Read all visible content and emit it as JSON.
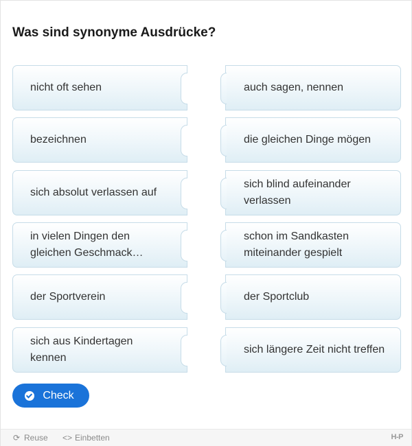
{
  "question": "Was sind synonyme Ausdrücke?",
  "pairs": [
    {
      "left": "nicht oft sehen",
      "right": "auch sagen, nennen"
    },
    {
      "left": "bezeichnen",
      "right": "die gleichen Dinge mögen"
    },
    {
      "left": "sich absolut verlassen auf",
      "right": "sich blind aufeinander verlassen"
    },
    {
      "left": "in vielen Dingen den gleichen Geschmack…",
      "right": "schon im Sandkasten miteinander gespielt"
    },
    {
      "left": "der Sportverein",
      "right": "der Sportclub"
    },
    {
      "left": "sich aus Kindertagen kennen",
      "right": "sich längere Zeit nicht treffen"
    }
  ],
  "check_button": {
    "label": "Check",
    "icon": "check-circle-icon"
  },
  "footer": {
    "reuse_label": "Reuse",
    "embed_label": "Einbetten",
    "logo": "H-P"
  },
  "colors": {
    "accent": "#1a73d9",
    "card_border": "#c6dce8",
    "card_bg": "#eef6fa"
  }
}
